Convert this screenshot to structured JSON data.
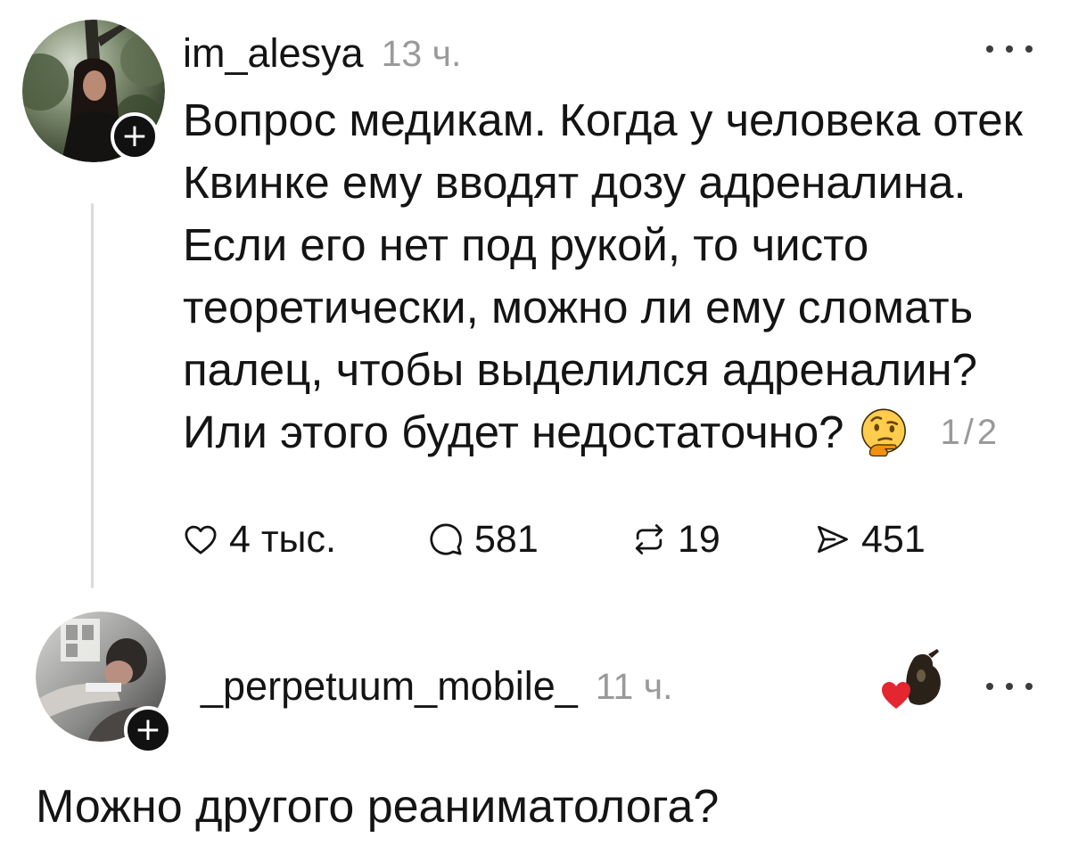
{
  "post": {
    "author": {
      "username": "im_alesya",
      "time": "13 ч.",
      "avatar": "profile-photo",
      "follow_badge": "+"
    },
    "more_icon": "more-options-icon",
    "text_lines": [
      "Вопрос медикам. Когда у человека отек",
      "Квинке ему вводят дозу адреналина.",
      "Если его нет под рукой, то чисто",
      "теоретически, можно ли ему сломать",
      "палец, чтобы выделился адреналин?",
      "Или этого будет недостаточно?"
    ],
    "emoji": "thinking-face",
    "thread_counter": "1/2",
    "actions": [
      {
        "icon": "heart-icon",
        "count": "4 тыс."
      },
      {
        "icon": "comment-icon",
        "count": "581"
      },
      {
        "icon": "repost-icon",
        "count": "19"
      },
      {
        "icon": "share-icon",
        "count": "451"
      }
    ]
  },
  "reply": {
    "author": {
      "username": "_perpetuum_mobile_",
      "time": "11 ч.",
      "avatar": "profile-photo",
      "follow_badge": "+"
    },
    "liked_by_author_icon": "author-liked-heart-icon",
    "more_icon": "more-options-icon",
    "text": "Можно другого реаниматолога?"
  },
  "colors": {
    "background": "#ffffff",
    "text": "#141414",
    "muted": "#9a9a9a",
    "thread_line": "#dadada",
    "badge": "#111111",
    "heart_red": "#e3262f",
    "emoji_yellow": "#ffcc4d"
  }
}
